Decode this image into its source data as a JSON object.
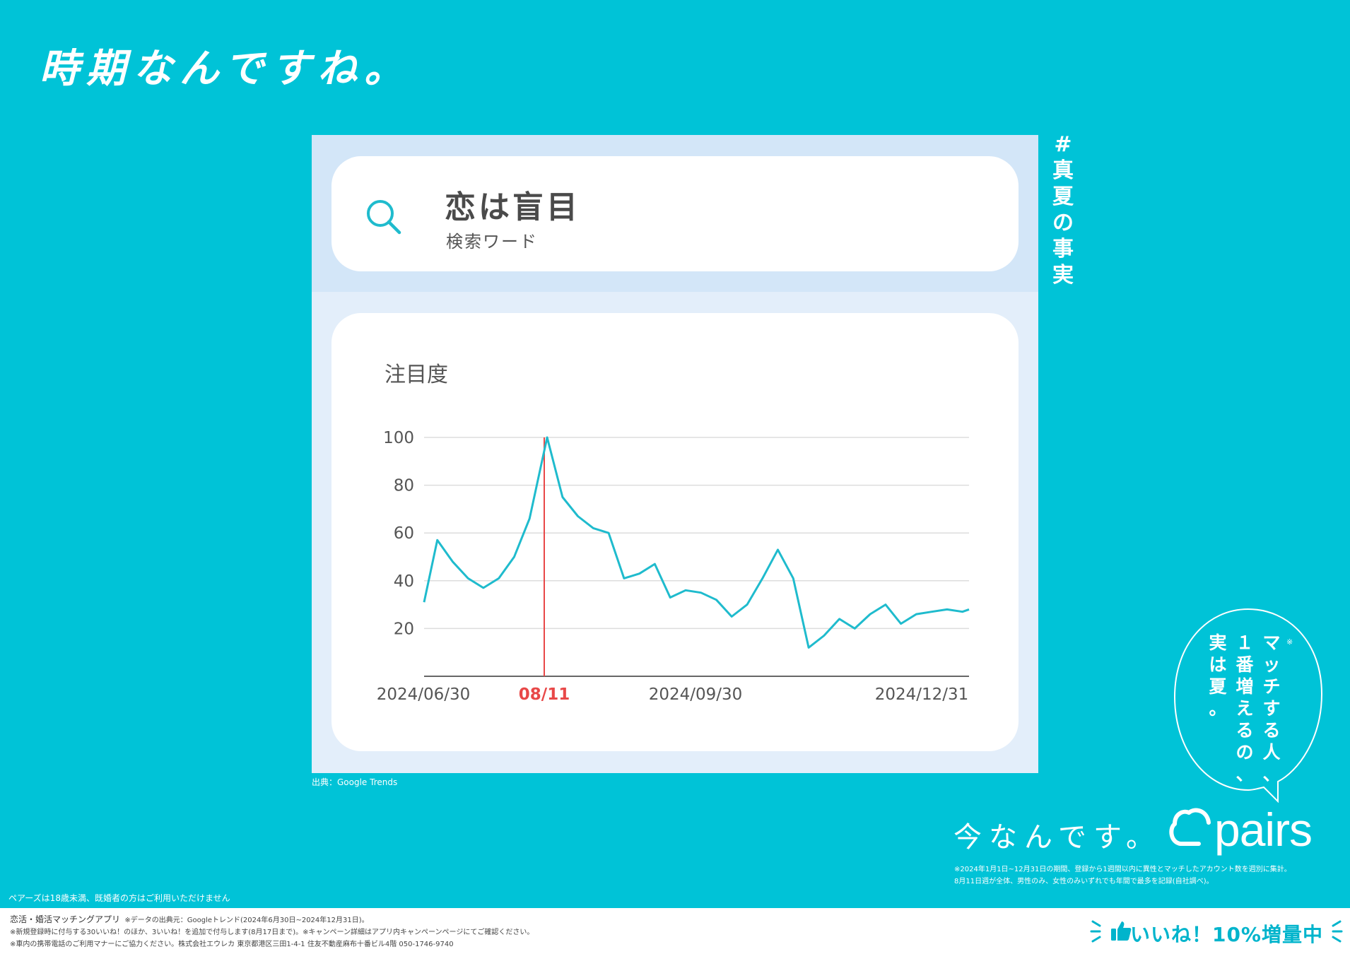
{
  "headline": "時期なんですね。",
  "search": {
    "term": "恋は盲目",
    "label": "検索ワード",
    "icon": "search-icon"
  },
  "hashtag": [
    "#",
    "真",
    "夏",
    "の",
    "事",
    "実"
  ],
  "chart_data": {
    "type": "line",
    "ylabel": "注目度",
    "yticks": [
      20,
      40,
      60,
      80,
      100
    ],
    "ylim": [
      0,
      100
    ],
    "xlim": [
      "2024-06-30",
      "2024-12-31"
    ],
    "x_tick_labels": [
      "2024/06/30",
      "08/11",
      "2024/09/30",
      "2024/12/31"
    ],
    "highlight": {
      "date": "2024-08-11",
      "label": "08/11",
      "value": 100
    },
    "series": [
      {
        "x": [
          "2024-06-30",
          "2024-07-07",
          "2024-07-14",
          "2024-07-21",
          "2024-07-28",
          "2024-08-04",
          "2024-08-11",
          "2024-08-18",
          "2024-08-25",
          "2024-09-01",
          "2024-09-08",
          "2024-09-15",
          "2024-09-22",
          "2024-09-29",
          "2024-10-06",
          "2024-10-13",
          "2024-10-20",
          "2024-10-27",
          "2024-11-03",
          "2024-11-10",
          "2024-11-17",
          "2024-11-24",
          "2024-12-01",
          "2024-12-08",
          "2024-12-15",
          "2024-12-22",
          "2024-12-29"
        ],
        "y": [
          31,
          57,
          48,
          41,
          37,
          41,
          50,
          100,
          75,
          67,
          62,
          60,
          41,
          43,
          47,
          33,
          36,
          35,
          32,
          25,
          30,
          41,
          53,
          12,
          18,
          24,
          20
        ]
      }
    ],
    "series_points": [
      [
        0,
        31
      ],
      [
        6,
        57
      ],
      [
        13,
        48
      ],
      [
        20,
        41
      ],
      [
        27,
        37
      ],
      [
        34,
        41
      ],
      [
        41,
        50
      ],
      [
        48,
        66
      ],
      [
        56,
        100
      ],
      [
        63,
        75
      ],
      [
        70,
        67
      ],
      [
        77,
        62
      ],
      [
        84,
        60
      ],
      [
        91,
        41
      ],
      [
        98,
        43
      ],
      [
        105,
        47
      ],
      [
        112,
        33
      ],
      [
        119,
        36
      ],
      [
        126,
        35
      ],
      [
        133,
        32
      ],
      [
        140,
        25
      ],
      [
        147,
        30
      ],
      [
        154,
        41
      ],
      [
        161,
        53
      ],
      [
        168,
        41
      ],
      [
        175,
        12
      ],
      [
        182,
        17
      ],
      [
        189,
        24
      ],
      [
        196,
        20
      ],
      [
        203,
        26
      ],
      [
        210,
        30
      ],
      [
        217,
        22
      ],
      [
        224,
        26
      ],
      [
        231,
        27
      ],
      [
        238,
        28
      ],
      [
        245,
        27
      ],
      [
        248,
        28
      ]
    ],
    "line_color": "#1fbbcd",
    "highlight_color": "#e84848"
  },
  "source": "出典：Google Trends",
  "bubble": {
    "lines": [
      "マッチする人、",
      "１番増えるの、",
      "実は夏。"
    ],
    "mark": "※"
  },
  "tagline": "今なんです。",
  "logo": "pairs",
  "note_right": [
    "※2024年1月1日~12月31日の期間、登録から1週間以内に異性とマッチしたアカウント数を週別に集計。",
    "8月11日週が全体、男性のみ、女性のみいずれでも年間で最多を記録(自社調べ)。"
  ],
  "age_note": "ペアーズは18歳未満、既婚者の方はご利用いただけません",
  "footer": {
    "lead": "恋活・婚活マッチングアプリ",
    "line1_rest": "※データの出典元：Googleトレンド(2024年6月30日~2024年12月31日)。",
    "line2": "※新規登録時に付与する30いいね！のほか、3いいね！を追加で付与します(8月17日まで)。※キャンペーン詳細はアプリ内キャンペーンページにてご確認ください。",
    "line3": "※車内の携帯電話のご利用マナーにご協力ください。株式会社エウレカ 東京都港区三田1-4-1 住友不動産麻布十番ビル4階 050-1746-9740",
    "promo": "いいね！10%増量中"
  },
  "colors": {
    "background": "#00c3d7",
    "panel": "#e3eefa",
    "panel_top": "#d3e6f8",
    "accent": "#1fbbcd",
    "highlight": "#e84848"
  }
}
